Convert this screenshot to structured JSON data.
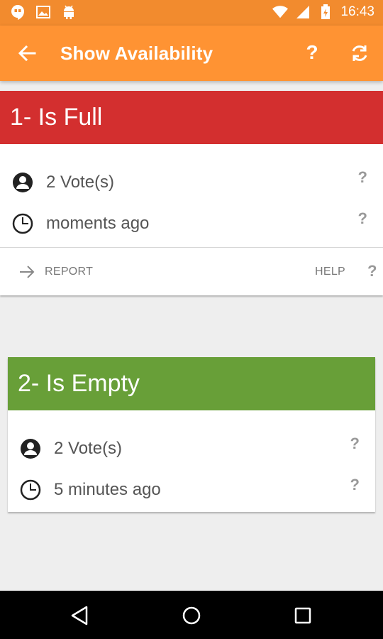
{
  "status_bar": {
    "time": "16:43",
    "left_icons": [
      "hangouts-icon",
      "image-icon",
      "android-icon"
    ],
    "right_icons": [
      "wifi-icon",
      "signal-icon",
      "battery-icon"
    ]
  },
  "appbar": {
    "title": "Show Availability",
    "help_label": "?",
    "color": "#ff9333"
  },
  "cards": [
    {
      "header": "1- Is Full",
      "color": "#d32f2f",
      "votes": "2 Vote(s)",
      "time": "moments ago",
      "votes_help": "?",
      "time_help": "?",
      "actions": {
        "report": "REPORT",
        "help": "HELP",
        "help_q": "?"
      }
    },
    {
      "header": "2- Is Empty",
      "color": "#689f38",
      "votes": "2 Vote(s)",
      "time": "5 minutes ago",
      "votes_help": "?",
      "time_help": "?"
    }
  ],
  "nav": [
    "back-nav-icon",
    "home-nav-icon",
    "recents-nav-icon"
  ]
}
